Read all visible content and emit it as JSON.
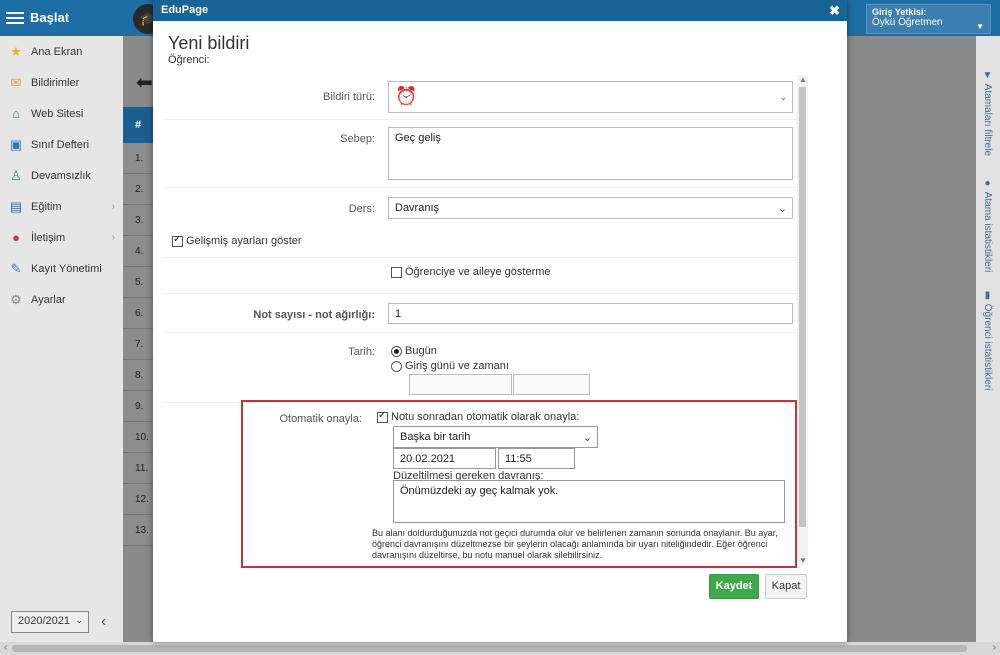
{
  "topbar": {
    "start_label": "Başlat",
    "login_label": "Giriş Yetkisi:",
    "login_user": "Öykü Öğretmen"
  },
  "sidebar": {
    "items": [
      {
        "label": "Ana Ekran",
        "icon": "star-icon"
      },
      {
        "label": "Bildirimler",
        "icon": "envelope-icon"
      },
      {
        "label": "Web Sitesi",
        "icon": "home-icon"
      },
      {
        "label": "Sınıf Defteri",
        "icon": "notebook-icon"
      },
      {
        "label": "Devamsızlık",
        "icon": "person-icon"
      },
      {
        "label": "Eğitim",
        "icon": "briefcase-icon"
      },
      {
        "label": "İletişim",
        "icon": "chat-icon"
      },
      {
        "label": "Kayıt Yönetimi",
        "icon": "pencil-icon"
      },
      {
        "label": "Ayarlar",
        "icon": "gear-icon"
      }
    ],
    "year": "2020/2021"
  },
  "background_table": {
    "header": "#",
    "rows": [
      "1.",
      "2.",
      "3.",
      "4.",
      "5.",
      "6.",
      "7.",
      "8.",
      "9.",
      "10.",
      "11.",
      "12.",
      "13."
    ]
  },
  "right_strip": {
    "items": [
      "Atamaları filtrele",
      "Atama istatistikleri",
      "Öğrenci istatistikleri"
    ]
  },
  "dialog": {
    "app_name": "EduPage",
    "close_symbol": "✖",
    "title": "Yeni bildiri",
    "subtitle": "Öğrenci:",
    "form": {
      "type_label": "Bildiri türü:",
      "type_icon": "alarm-clock-icon",
      "reason_label": "Sebep:",
      "reason_value": "Geç geliş",
      "subject_label": "Ders:",
      "subject_value": "Davranış",
      "advanced_label": "Gelişmiş ayarları göster",
      "hide_label": "Öğrenciye ve aileye gösterme",
      "grade_label": "Not sayısı - not ağırlığı:",
      "grade_value": "1",
      "date_label": "Tarih:",
      "date_option_today": "Bugün",
      "date_option_custom": "Giriş günü ve zamanı",
      "auto_label": "Otomatik onayla:",
      "auto_check_label": "Notu sonradan otomatik olarak onayla:",
      "auto_select_value": "Başka bir tarih",
      "auto_date": "20.02.2021",
      "auto_time": "11:55",
      "behavior_label": "Düzeltilmesi gereken davranış:",
      "behavior_value": "Önümüzdeki ay geç kalmak yok.",
      "help_text": "Bu alanı doldurduğunuzda not geçici durumda olur ve belirlenen zamanın sonunda onaylanır. Bu ayar, öğrenci davranışını düzeltmezse bir şeylerin olacağı anlamında bir uyarı niteliğindedir. Eğer öğrenci davranışını düzeltirse, bu notu manuel olarak silebilirsiniz."
    },
    "save_label": "Kaydet",
    "close_label": "Kapat"
  },
  "colors": {
    "header": "#196396",
    "save": "#3fa84a",
    "highlight": "#c0353a"
  }
}
